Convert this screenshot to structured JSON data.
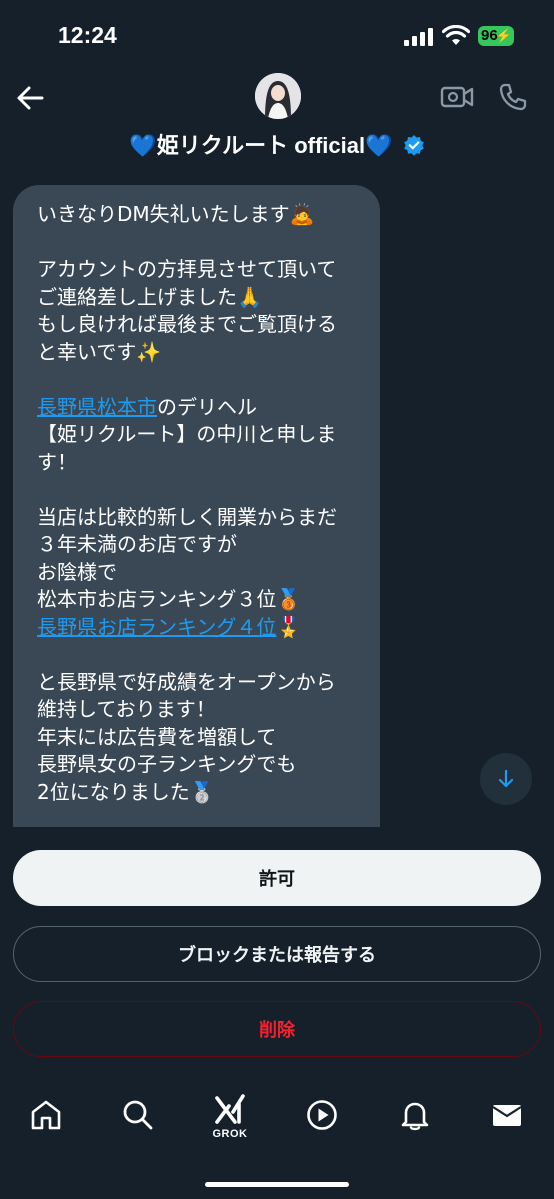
{
  "status": {
    "time": "12:24",
    "battery": "96"
  },
  "header": {
    "title": "💙姫リクルート official💙"
  },
  "message": {
    "lines": [
      [
        {
          "t": "いきなりDM失礼いたします🙇"
        }
      ],
      [],
      [
        {
          "t": "アカウントの方拝見させて頂いて"
        }
      ],
      [
        {
          "t": "ご連絡差し上げました🙏"
        }
      ],
      [
        {
          "t": "もし良ければ最後までご覧頂ける"
        }
      ],
      [
        {
          "t": "と幸いです✨"
        }
      ],
      [],
      [
        {
          "t": "長野県松本市",
          "link": true
        },
        {
          "t": "のデリヘル"
        }
      ],
      [
        {
          "t": "【姫リクルート】の中川と申しま"
        }
      ],
      [
        {
          "t": "す！"
        }
      ],
      [],
      [
        {
          "t": "当店は比較的新しく開業からまだ"
        }
      ],
      [
        {
          "t": "３年未満のお店ですが"
        }
      ],
      [
        {
          "t": "お陰様で"
        }
      ],
      [
        {
          "t": "松本市お店ランキング３位🥉"
        }
      ],
      [
        {
          "t": "長野県お店ランキング４位",
          "link": true
        },
        {
          "t": "🎖️"
        }
      ],
      [],
      [
        {
          "t": "と長野県で好成績をオープンから"
        }
      ],
      [
        {
          "t": "維持しております！"
        }
      ],
      [
        {
          "t": "年末には広告費を増額して"
        }
      ],
      [
        {
          "t": "長野県女の子ランキングでも"
        }
      ],
      [
        {
          "t": "2位になりました🥈"
        }
      ]
    ]
  },
  "actions": {
    "allow": "許可",
    "block": "ブロックまたは報告する",
    "delete": "削除"
  },
  "tabs": {
    "grok_label": "GROK"
  },
  "icons": [
    "signal-icon",
    "wifi-icon",
    "back-arrow-icon",
    "video-call-icon",
    "phone-call-icon",
    "verified-badge-icon",
    "arrow-down-icon",
    "home-icon",
    "search-icon",
    "grok-icon",
    "play-icon",
    "bell-icon",
    "mail-icon"
  ],
  "colors": {
    "background": "#15202b",
    "bubble": "#3a4856",
    "link": "#1d9bf0",
    "delete": "#f4212e",
    "battery": "#34c759"
  }
}
